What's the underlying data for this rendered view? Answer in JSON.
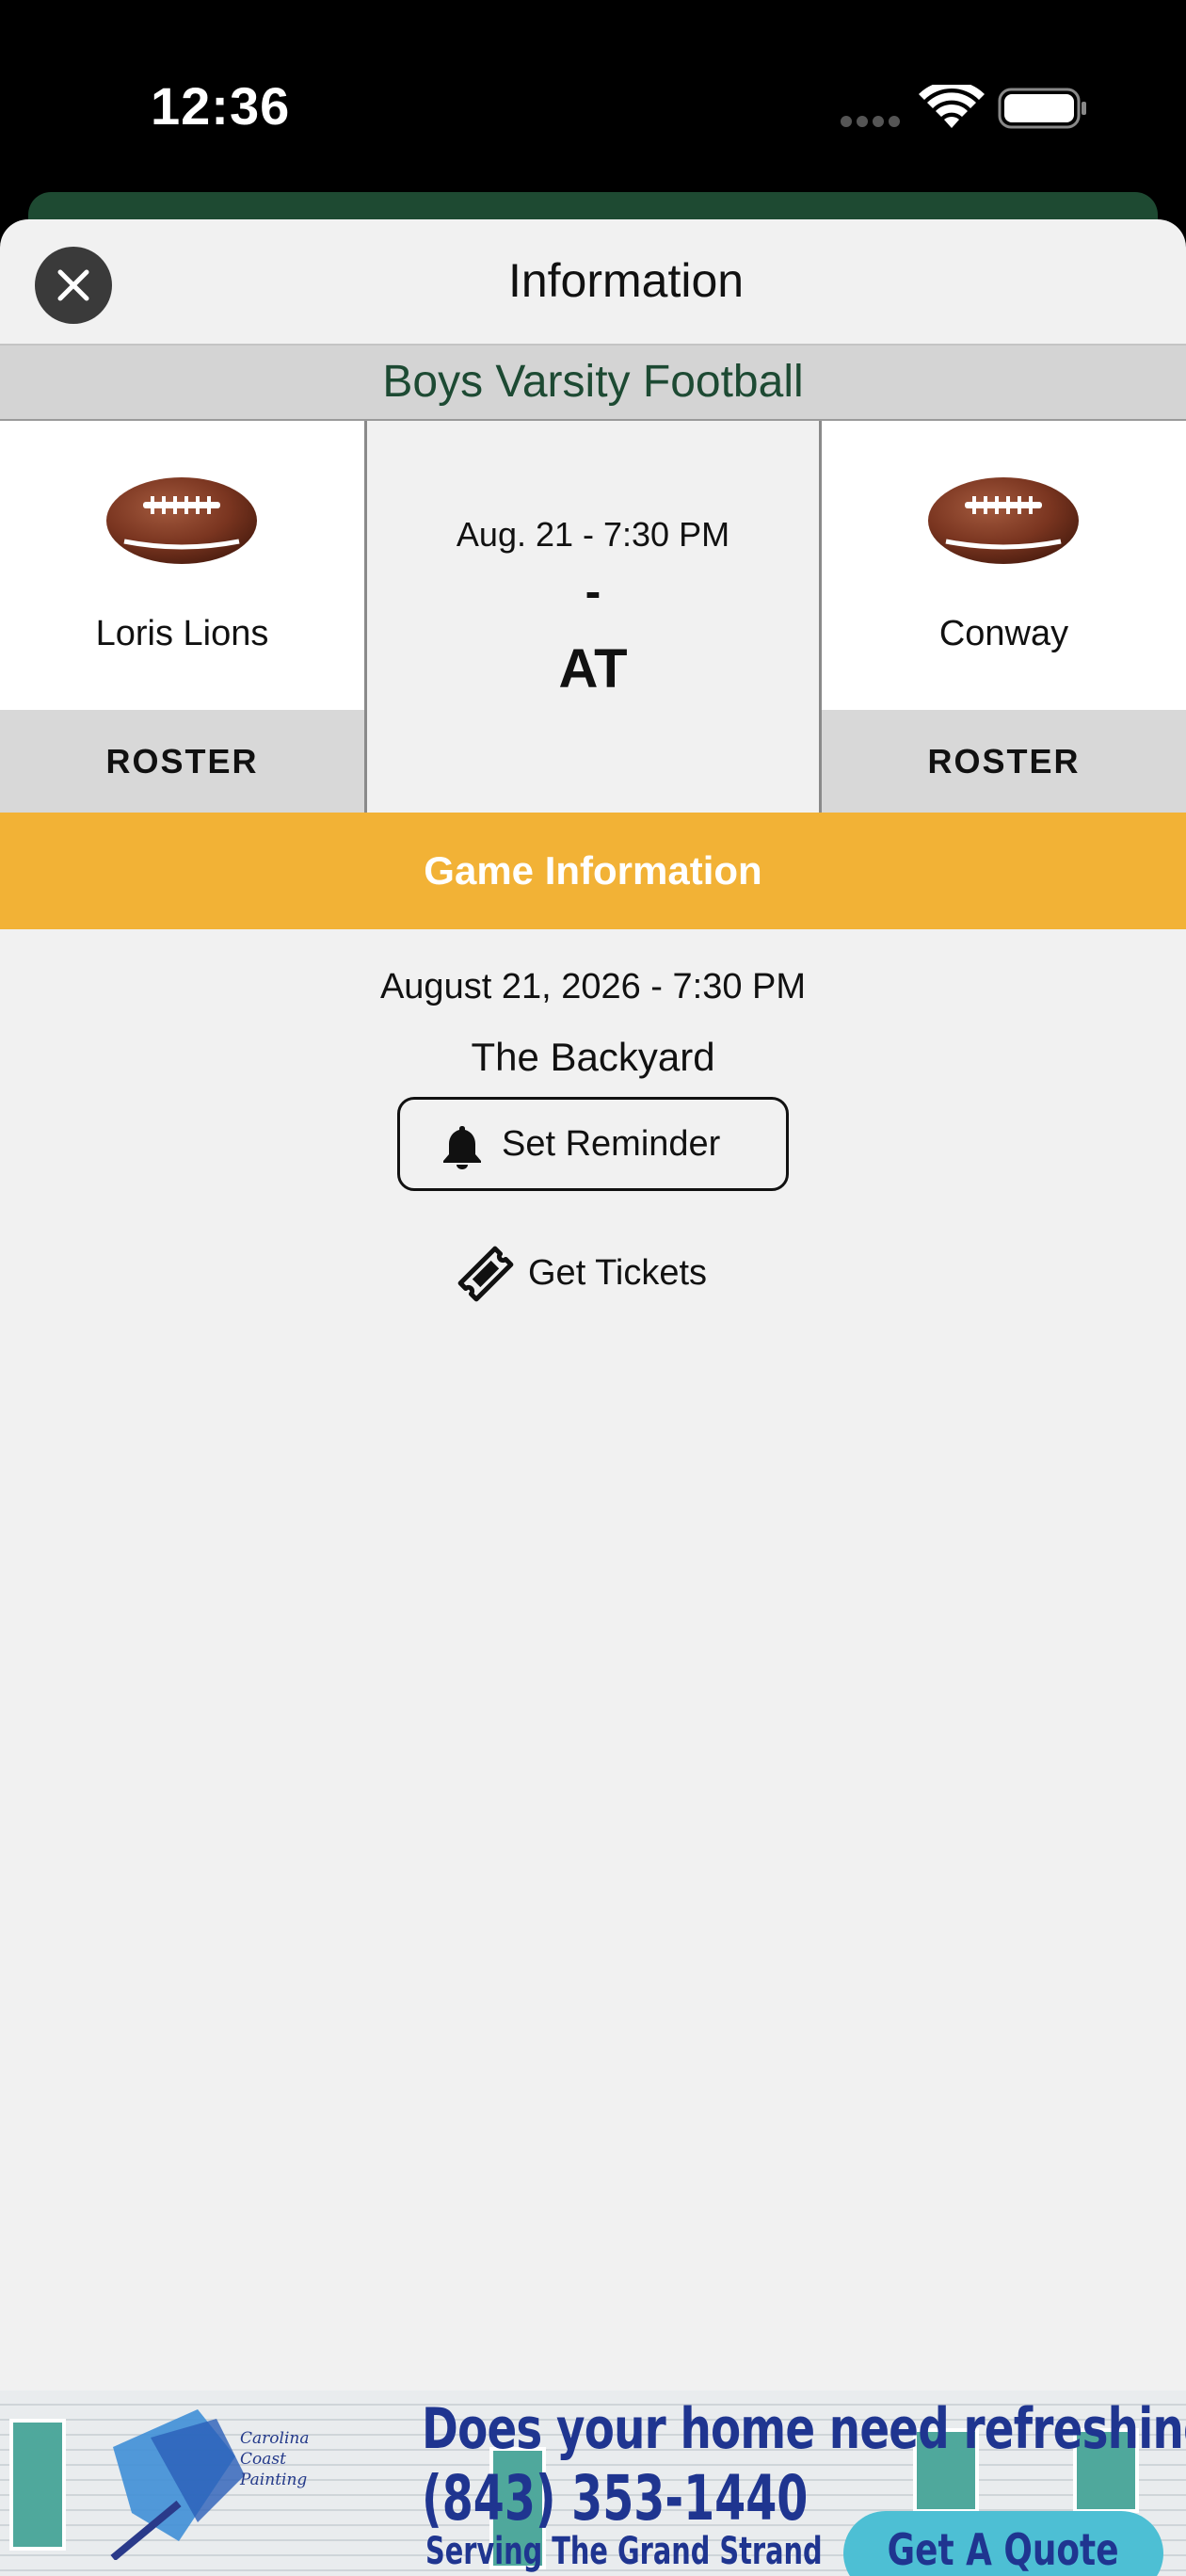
{
  "status_bar": {
    "time": "12:36"
  },
  "sheet": {
    "title": "Information"
  },
  "sport": {
    "name": "Boys Varsity Football"
  },
  "matchup": {
    "home_team": {
      "name": "Loris Lions",
      "roster_label": "ROSTER",
      "icon": "football-icon"
    },
    "away_team": {
      "name": "Conway",
      "roster_label": "ROSTER",
      "icon": "football-icon"
    },
    "date_short": "Aug. 21 - 7:30 PM",
    "score": "-",
    "relation": "AT"
  },
  "game_info": {
    "header": "Game Information",
    "date_full": "August 21, 2026 - 7:30 PM",
    "venue": "The Backyard",
    "reminder_label": "Set Reminder",
    "tickets_label": "Get Tickets"
  },
  "ad": {
    "brand_lines": [
      "Carolina",
      "Coast",
      "Painting"
    ],
    "headline": "Does your home need refreshing?",
    "phone": "(843) 353-1440",
    "tagline": "Serving The Grand Strand",
    "cta": "Get A Quote"
  },
  "colors": {
    "brand_green": "#1d4a33",
    "accent_gold": "#f2b236",
    "ad_blue": "#1f3590",
    "ad_cta": "#4dbfd4"
  }
}
